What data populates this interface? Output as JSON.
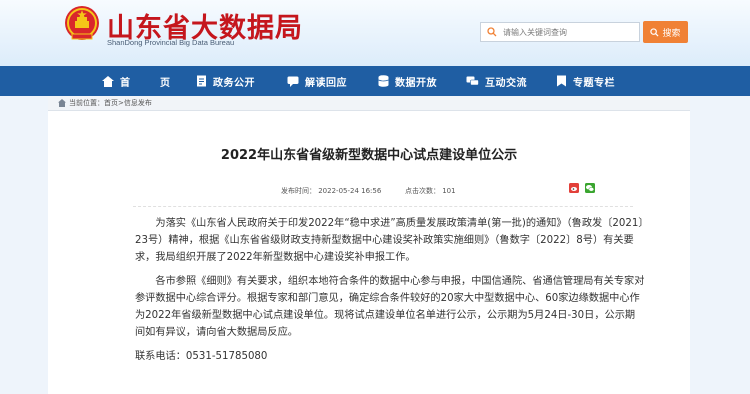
{
  "header": {
    "site_title": "山东省大数据局",
    "site_subtitle": "ShanDong Provincial Big Data Bureau",
    "search_placeholder": "请输入关键词查询",
    "search_button": "搜索"
  },
  "nav": {
    "items": [
      {
        "label": "首　页",
        "icon": "home-icon"
      },
      {
        "label": "政务公开",
        "icon": "document-icon"
      },
      {
        "label": "解读回应",
        "icon": "chat-bubble-icon"
      },
      {
        "label": "数据开放",
        "icon": "database-icon"
      },
      {
        "label": "互动交流",
        "icon": "comments-icon"
      },
      {
        "label": "专题专栏",
        "icon": "bookmark-icon"
      }
    ]
  },
  "breadcrumb": {
    "text": "当前位置：首页>信息发布"
  },
  "article": {
    "title": "2022年山东省省级新型数据中心试点建设单位公示",
    "published": "发布时间： 2022-05-24 16:56",
    "hits": "点击次数： 101",
    "paragraphs": [
      "为落实《山东省人民政府关于印发2022年“稳中求进”高质量发展政策清单(第一批)的通知》（鲁政发〔2021〕23号）精神，根据《山东省省级财政支持新型数据中心建设奖补政策实施细则》（鲁数字〔2022〕8号）有关要求，我局组织开展了2022年新型数据中心建设奖补申报工作。",
      "各市参照《细则》有关要求，组织本地符合条件的数据中心参与申报，中国信通院、省通信管理局有关专家对参评数据中心综合评分。根据专家和部门意见，确定综合条件较好的20家大中型数据中心、60家边缘数据中心作为2022年省级新型数据中心试点建设单位。现将试点建设单位名单进行公示，公示期为5月24日-30日，公示期间如有异议，请向省大数据局反应。"
    ],
    "contact": "联系电话：0531-51785080"
  },
  "colors": {
    "brand_red": "#c5161d",
    "nav_blue": "#1f5ea3",
    "search_orange": "#f08135"
  }
}
